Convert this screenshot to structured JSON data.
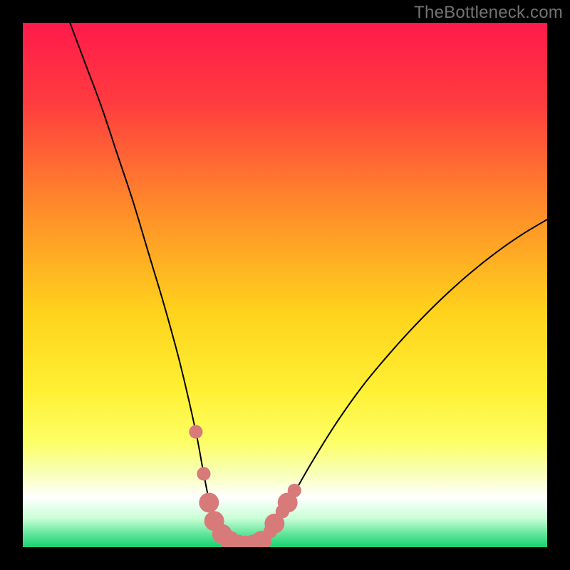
{
  "watermark": "TheBottleneck.com",
  "chart_data": {
    "type": "line",
    "title": "",
    "xlabel": "",
    "ylabel": "",
    "xlim": [
      0,
      100
    ],
    "ylim": [
      0,
      100
    ],
    "gradient_stops": [
      {
        "offset": 0.0,
        "color": "#ff1a4b"
      },
      {
        "offset": 0.15,
        "color": "#ff3b3f"
      },
      {
        "offset": 0.35,
        "color": "#ff8a2a"
      },
      {
        "offset": 0.55,
        "color": "#ffd21c"
      },
      {
        "offset": 0.7,
        "color": "#fff033"
      },
      {
        "offset": 0.8,
        "color": "#fdff66"
      },
      {
        "offset": 0.86,
        "color": "#f8ffb8"
      },
      {
        "offset": 0.905,
        "color": "#ffffff"
      },
      {
        "offset": 0.945,
        "color": "#c9ffd6"
      },
      {
        "offset": 0.975,
        "color": "#5fe59a"
      },
      {
        "offset": 1.0,
        "color": "#17d372"
      }
    ],
    "series": [
      {
        "name": "bottleneck-curve",
        "stroke": "#000000",
        "x": [
          9.0,
          12.0,
          15.0,
          18.0,
          21.0,
          24.0,
          27.0,
          30.0,
          33.0,
          34.5,
          36.0,
          38.0,
          40.0,
          42.0,
          44.0,
          46.0,
          48.0,
          51.0,
          55.0,
          60.0,
          65.0,
          70.0,
          75.0,
          80.0,
          85.0,
          90.0,
          95.0,
          100.0
        ],
        "values": [
          100.0,
          92.0,
          84.0,
          75.0,
          66.0,
          56.0,
          46.0,
          35.0,
          22.0,
          14.0,
          7.0,
          2.5,
          0.7,
          0.3,
          0.4,
          1.5,
          4.0,
          9.0,
          16.0,
          24.0,
          31.0,
          37.0,
          42.5,
          47.5,
          52.0,
          56.0,
          59.5,
          62.5
        ]
      }
    ],
    "markers": {
      "name": "highlight-dots",
      "color": "#d97a7a",
      "big_radius_pct": 1.9,
      "small_radius_pct": 1.3,
      "points": [
        {
          "x": 33.0,
          "y": 22.0,
          "size": "small"
        },
        {
          "x": 34.5,
          "y": 14.0,
          "size": "small"
        },
        {
          "x": 35.5,
          "y": 8.5,
          "size": "big"
        },
        {
          "x": 36.5,
          "y": 5.0,
          "size": "big"
        },
        {
          "x": 38.0,
          "y": 2.5,
          "size": "big"
        },
        {
          "x": 39.5,
          "y": 1.2,
          "size": "big"
        },
        {
          "x": 41.0,
          "y": 0.5,
          "size": "big"
        },
        {
          "x": 42.5,
          "y": 0.3,
          "size": "big"
        },
        {
          "x": 44.0,
          "y": 0.5,
          "size": "big"
        },
        {
          "x": 45.5,
          "y": 1.2,
          "size": "big"
        },
        {
          "x": 47.2,
          "y": 3.0,
          "size": "small"
        },
        {
          "x": 48.0,
          "y": 4.5,
          "size": "big"
        },
        {
          "x": 49.5,
          "y": 6.8,
          "size": "small"
        },
        {
          "x": 50.5,
          "y": 8.5,
          "size": "big"
        },
        {
          "x": 51.8,
          "y": 10.8,
          "size": "small"
        }
      ]
    }
  }
}
